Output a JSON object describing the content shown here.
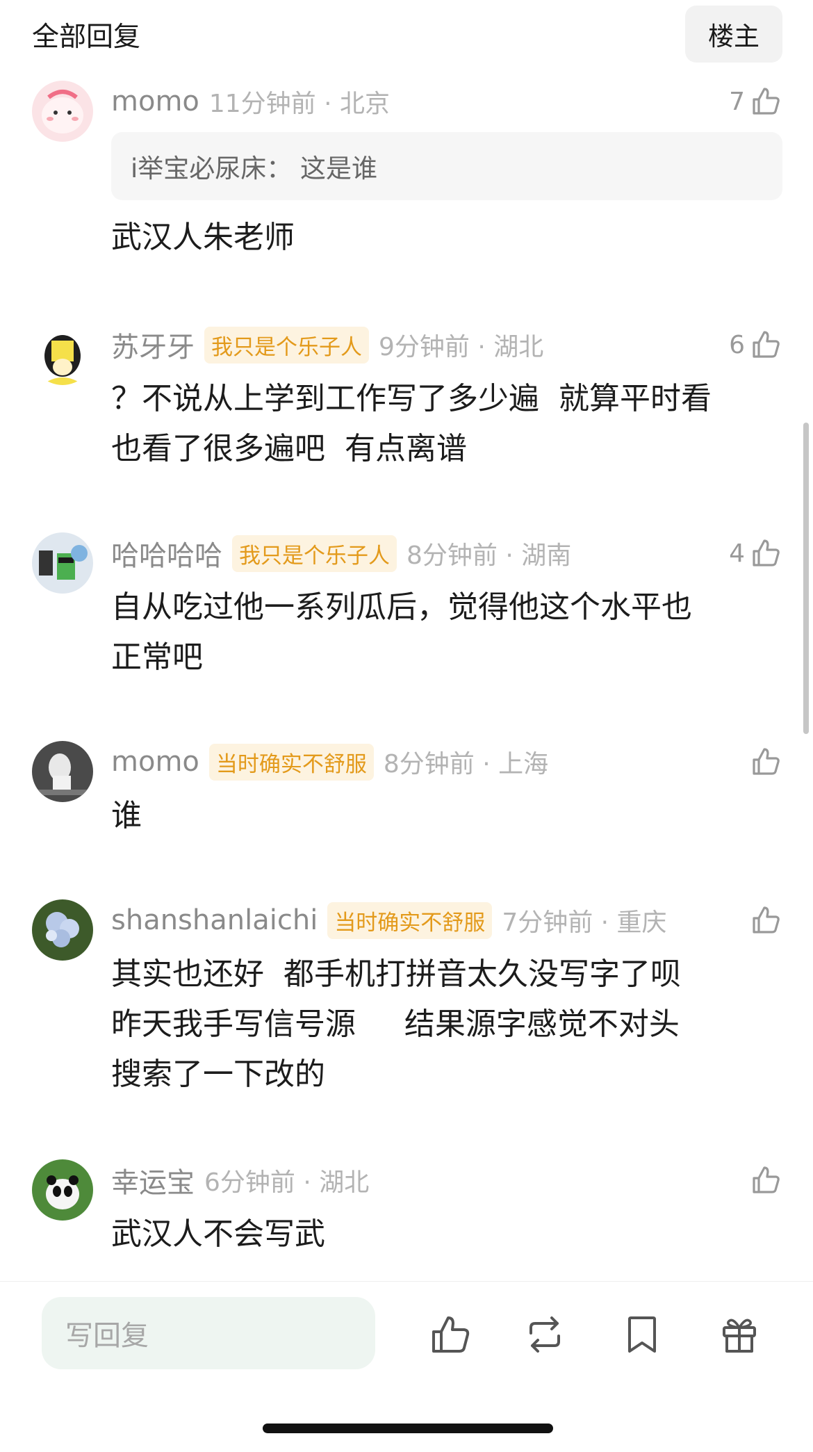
{
  "header": {
    "title": "全部回复",
    "owner_button": "楼主"
  },
  "comments": [
    {
      "username": "momo",
      "tag": "",
      "time": "11分钟前 · 北京",
      "likes": "7",
      "quote": "i举宝必尿床：  这是谁",
      "text": "武汉人朱老师"
    },
    {
      "username": "苏牙牙",
      "tag": "我只是个乐子人",
      "time": "9分钟前 · 湖北",
      "likes": "6",
      "text": "？不说从上学到工作写了多少遍  就算平时看\n也看了很多遍吧  有点离谱"
    },
    {
      "username": "哈哈哈哈",
      "tag": "我只是个乐子人",
      "time": "8分钟前 · 湖南",
      "likes": "4",
      "text": "自从吃过他一系列瓜后，觉得他这个水平也\n正常吧"
    },
    {
      "username": "momo",
      "tag": "当时确实不舒服",
      "time": "8分钟前 · 上海",
      "likes": "",
      "text": "谁"
    },
    {
      "username": "shanshanlaichi",
      "tag": "当时确实不舒服",
      "time": "7分钟前 · 重庆",
      "likes": "",
      "text": "其实也还好  都手机打拼音太久没写字了呗\n昨天我手写信号源     结果源字感觉不对头\n搜索了一下改的"
    },
    {
      "username": "幸运宝",
      "tag": "",
      "time": "6分钟前 · 湖北",
      "likes": "",
      "text": "武汉人不会写武"
    }
  ],
  "bottom_bar": {
    "reply_placeholder": "写回复"
  },
  "colors": {
    "tag_text": "#e39a1b",
    "tag_bg": "#fdf3e0",
    "input_bg": "#eef5f1"
  },
  "icons": [
    "thumbs-up-icon",
    "repost-icon",
    "bookmark-icon",
    "gift-icon"
  ]
}
